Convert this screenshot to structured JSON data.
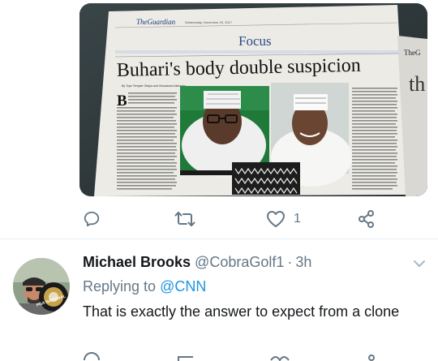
{
  "newspaper": {
    "masthead": "TheGuardian",
    "dateline": "Wednesday, November 29, 2017",
    "section": "Focus",
    "headline": "Buhari's body double suspicion",
    "byline": "By Tope Templer Olaiya and Oluwatosin Akinosho",
    "drop_cap": "B",
    "adjacent_page_masthead": "TheG",
    "adjacent_page_letter": "th"
  },
  "tweet_actions": {
    "reply_icon": "reply-icon",
    "retweet_icon": "retweet-icon",
    "like_icon": "heart-icon",
    "like_count": "1",
    "share_icon": "share-icon"
  },
  "reply": {
    "display_name": "Michael Brooks",
    "handle": "@CobraGolf1",
    "separator": "·",
    "time": "3h",
    "replying_label": "Replying to",
    "replying_to": "@CNN",
    "text": "That is exactly the answer to expect from a clone",
    "avatar_badge_text": "PGA NATIONAL",
    "menu_icon": "chevron-down-icon"
  },
  "colors": {
    "text_primary": "#14171a",
    "text_secondary": "#657786",
    "link": "#1b95e0",
    "divider": "#e6ecf0",
    "icon": "#657786"
  }
}
